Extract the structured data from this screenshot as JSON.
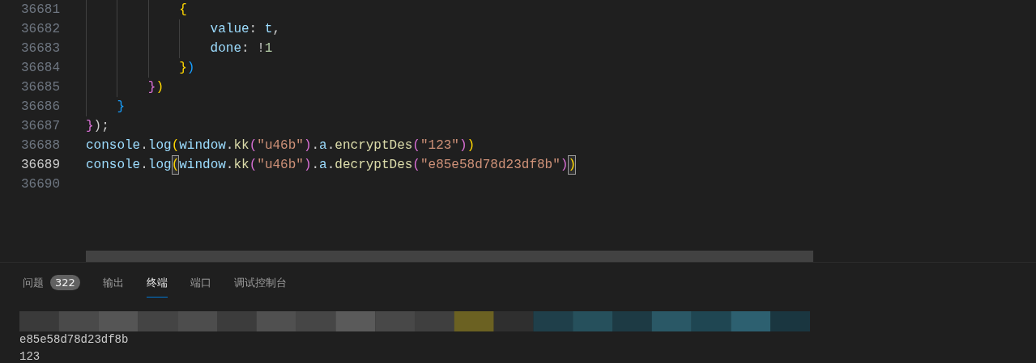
{
  "editor": {
    "lines": [
      {
        "children": [
          {
            "children": [
              {
                "children": [
                  {
                    "number": "36681",
                    "active": false,
                    "tokens": [
                      {
                        "text": "{",
                        "kind": "bracket1",
                        "matched": false
                      }
                    ]
                  },
                  {
                    "children": [
                      {
                        "number": "36682",
                        "active": false,
                        "tokens": [
                          {
                            "text": "value",
                            "kind": "variable",
                            "matched": false
                          },
                          {
                            "text": ":",
                            "kind": "plain",
                            "matched": false
                          },
                          {
                            "text": " t",
                            "kind": "variable",
                            "matched": false
                          },
                          {
                            "text": ",",
                            "kind": "plain",
                            "matched": false
                          }
                        ]
                      },
                      {
                        "number": "36683",
                        "active": false,
                        "tokens": [
                          {
                            "text": "done",
                            "kind": "variable",
                            "matched": false
                          },
                          {
                            "text": ": !",
                            "kind": "plain",
                            "matched": false
                          },
                          {
                            "text": "1",
                            "kind": "number",
                            "matched": false
                          }
                        ]
                      }
                    ]
                  },
                  {
                    "number": "36684",
                    "active": false,
                    "tokens": [
                      {
                        "text": "}",
                        "kind": "bracket1",
                        "matched": false
                      },
                      {
                        "text": ")",
                        "kind": "bracket3",
                        "matched": false
                      }
                    ]
                  }
                ]
              },
              {
                "number": "36685",
                "active": false,
                "tokens": [
                  {
                    "text": "}",
                    "kind": "bracket2",
                    "matched": false
                  },
                  {
                    "text": ")",
                    "kind": "bracket1",
                    "matched": false
                  }
                ]
              }
            ]
          },
          {
            "number": "36686",
            "active": false,
            "tokens": [
              {
                "text": "}",
                "kind": "bracket3",
                "matched": false
              }
            ]
          }
        ]
      },
      {
        "number": "36687",
        "active": false,
        "tokens": [
          {
            "text": "}",
            "kind": "bracket2",
            "matched": false
          },
          {
            "text": ");",
            "kind": "plain",
            "matched": false
          }
        ]
      },
      {
        "number": "36688",
        "active": false,
        "tokens": [
          {
            "text": "console",
            "kind": "variable",
            "matched": false
          },
          {
            "text": ".",
            "kind": "plain",
            "matched": false
          },
          {
            "text": "log",
            "kind": "variable",
            "matched": false
          },
          {
            "text": "(",
            "kind": "bracket1",
            "matched": false
          },
          {
            "text": "window",
            "kind": "variable",
            "matched": false
          },
          {
            "text": ".",
            "kind": "plain",
            "matched": false
          },
          {
            "text": "kk",
            "kind": "function",
            "matched": false
          },
          {
            "text": "(",
            "kind": "bracket2",
            "matched": false
          },
          {
            "text": "\"u46b\"",
            "kind": "string",
            "matched": false
          },
          {
            "text": ")",
            "kind": "bracket2",
            "matched": false
          },
          {
            "text": ".",
            "kind": "plain",
            "matched": false
          },
          {
            "text": "a",
            "kind": "variable",
            "matched": false
          },
          {
            "text": ".",
            "kind": "plain",
            "matched": false
          },
          {
            "text": "encryptDes",
            "kind": "function",
            "matched": false
          },
          {
            "text": "(",
            "kind": "bracket2",
            "matched": false
          },
          {
            "text": "\"123\"",
            "kind": "string",
            "matched": false
          },
          {
            "text": ")",
            "kind": "bracket2",
            "matched": false
          },
          {
            "text": ")",
            "kind": "bracket1",
            "matched": false
          }
        ]
      },
      {
        "number": "36689",
        "active": true,
        "tokens": [
          {
            "text": "console",
            "kind": "variable",
            "matched": false
          },
          {
            "text": ".",
            "kind": "plain",
            "matched": false
          },
          {
            "text": "log",
            "kind": "variable",
            "matched": false
          },
          {
            "text": "(",
            "kind": "bracket1",
            "matched": true
          },
          {
            "text": "window",
            "kind": "variable",
            "matched": false
          },
          {
            "text": ".",
            "kind": "plain",
            "matched": false
          },
          {
            "text": "kk",
            "kind": "function",
            "matched": false
          },
          {
            "text": "(",
            "kind": "bracket2",
            "matched": false
          },
          {
            "text": "\"u46b\"",
            "kind": "string",
            "matched": false
          },
          {
            "text": ")",
            "kind": "bracket2",
            "matched": false
          },
          {
            "text": ".",
            "kind": "plain",
            "matched": false
          },
          {
            "text": "a",
            "kind": "variable",
            "matched": false
          },
          {
            "text": ".",
            "kind": "plain",
            "matched": false
          },
          {
            "text": "decryptDes",
            "kind": "function",
            "matched": false
          },
          {
            "text": "(",
            "kind": "bracket2",
            "matched": false
          },
          {
            "text": "\"e85e58d78d23df8b\"",
            "kind": "string",
            "matched": false
          },
          {
            "text": ")",
            "kind": "bracket2",
            "matched": false
          },
          {
            "text": ")",
            "kind": "bracket1",
            "matched": true
          }
        ]
      },
      {
        "number": "36690",
        "active": false
      }
    ]
  },
  "panel": {
    "tabs": [
      {
        "label": "问题",
        "badge": "322",
        "selected": false
      },
      {
        "label": "输出",
        "selected": false
      },
      {
        "label": "终端",
        "selected": true
      },
      {
        "label": "端口",
        "selected": false
      },
      {
        "label": "调试控制台",
        "selected": false
      }
    ],
    "terminal": {
      "blurred": {
        "kind": "picture"
      },
      "lines": [
        "e85e58d78d23df8b",
        "123"
      ]
    }
  }
}
